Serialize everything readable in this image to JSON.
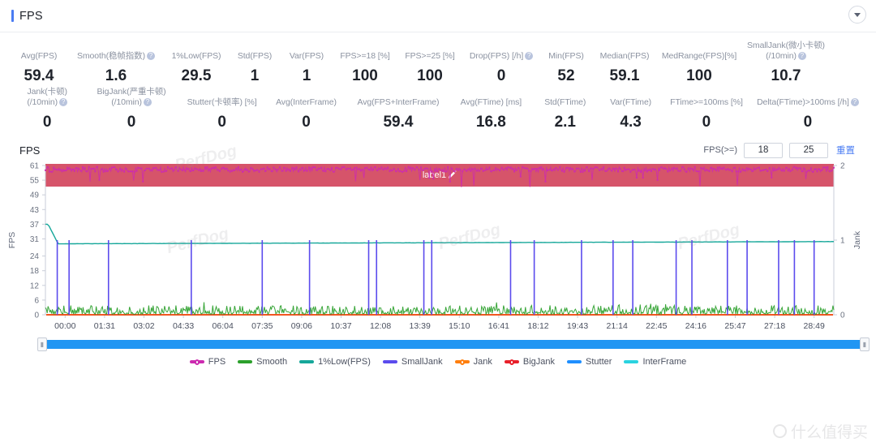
{
  "header": {
    "title": "FPS",
    "collapse_icon": "chevron-down-icon"
  },
  "metrics_rows": [
    [
      {
        "label": "Avg(FPS)",
        "value": "59.4",
        "help": false
      },
      {
        "label": "Smooth(稳帧指数)",
        "value": "1.6",
        "help": true
      },
      {
        "label": "1%Low(FPS)",
        "value": "29.5",
        "help": false
      },
      {
        "label": "Std(FPS)",
        "value": "1",
        "help": false
      },
      {
        "label": "Var(FPS)",
        "value": "1",
        "help": false
      },
      {
        "label": "FPS>=18 [%]",
        "value": "100",
        "help": false
      },
      {
        "label": "FPS>=25 [%]",
        "value": "100",
        "help": false
      },
      {
        "label": "Drop(FPS) [/h]",
        "value": "0",
        "help": true
      },
      {
        "label": "Min(FPS)",
        "value": "52",
        "help": false
      },
      {
        "label": "Median(FPS)",
        "value": "59.1",
        "help": false
      },
      {
        "label": "MedRange(FPS)[%]",
        "value": "100",
        "help": false
      },
      {
        "label": "SmallJank(微小卡顿)\n(/10min)",
        "value": "10.7",
        "help": true
      }
    ],
    [
      {
        "label": "Jank(卡顿)\n(/10min)",
        "value": "0",
        "help": true
      },
      {
        "label": "BigJank(严重卡顿)\n(/10min)",
        "value": "0",
        "help": true
      },
      {
        "label": "Stutter(卡顿率) [%]",
        "value": "0",
        "help": false
      },
      {
        "label": "Avg(InterFrame)",
        "value": "0",
        "help": false
      },
      {
        "label": "Avg(FPS+InterFrame)",
        "value": "59.4",
        "help": false
      },
      {
        "label": "Avg(FTime) [ms]",
        "value": "16.8",
        "help": false
      },
      {
        "label": "Std(FTime)",
        "value": "2.1",
        "help": false
      },
      {
        "label": "Var(FTime)",
        "value": "4.3",
        "help": false
      },
      {
        "label": "FTime>=100ms [%]",
        "value": "0",
        "help": false
      },
      {
        "label": "Delta(FTime)>100ms [/h]",
        "value": "0",
        "help": true
      }
    ]
  ],
  "chart_header": {
    "title": "FPS",
    "fps_gte_label": "FPS(>=)",
    "threshold_low": "18",
    "threshold_high": "25",
    "reset_label": "重置"
  },
  "label_band": {
    "text": "label1",
    "edit_icon": "pencil-icon",
    "color": "#d6546a"
  },
  "range_slider": {
    "start_pct": 0,
    "end_pct": 100,
    "color": "#2196f3"
  },
  "legend": [
    {
      "label": "FPS",
      "color": "#cc2bb0",
      "style": "dotted"
    },
    {
      "label": "Smooth",
      "color": "#2ca02c",
      "style": "line"
    },
    {
      "label": "1%Low(FPS)",
      "color": "#16a79a",
      "style": "line"
    },
    {
      "label": "SmallJank",
      "color": "#5b4bed",
      "style": "line"
    },
    {
      "label": "Jank",
      "color": "#ff7f0e",
      "style": "dotted"
    },
    {
      "label": "BigJank",
      "color": "#e8202a",
      "style": "dotted"
    },
    {
      "label": "Stutter",
      "color": "#1f8fff",
      "style": "line"
    },
    {
      "label": "InterFrame",
      "color": "#2ad3e0",
      "style": "line"
    }
  ],
  "watermarks": [
    "PerfDog",
    "PerfDog",
    "PerfDog",
    "PerfDog"
  ],
  "brand_watermark": "什么值得买",
  "chart_data": {
    "type": "line",
    "title": "FPS",
    "xlabel": "",
    "ylabel": "FPS",
    "y2label": "Jank",
    "ylim": [
      0,
      61
    ],
    "y2lim": [
      0,
      2
    ],
    "yticks": [
      0,
      6,
      12,
      18,
      24,
      31,
      37,
      43,
      49,
      55,
      61
    ],
    "y2ticks": [
      0,
      1,
      2
    ],
    "xticks": [
      "00:00",
      "01:31",
      "03:02",
      "04:33",
      "06:04",
      "07:35",
      "09:06",
      "10:37",
      "12:08",
      "13:39",
      "15:10",
      "16:41",
      "18:12",
      "19:43",
      "21:14",
      "22:45",
      "24:16",
      "25:47",
      "27:18",
      "28:49"
    ],
    "grid": false,
    "legend_position": "bottom",
    "series": [
      {
        "name": "FPS",
        "color": "#cc2bb0",
        "axis": "left",
        "description": "Dense scatter/line oscillating around 59-60 with occasional dips to 52-57",
        "mean": 59.4,
        "min": 52,
        "max": 61,
        "median": 59.1
      },
      {
        "name": "Smooth",
        "color": "#2ca02c",
        "axis": "left",
        "description": "Noisy low-amplitude band between 0 and 5",
        "mean": 1.6,
        "min": 0,
        "max": 5
      },
      {
        "name": "1%Low(FPS)",
        "color": "#16a79a",
        "axis": "left",
        "description": "Starts near 37, drops quickly to ~29 and stays flat",
        "mean": 29.5,
        "start": 37,
        "settle": 29.5
      },
      {
        "name": "SmallJank",
        "color": "#5b4bed",
        "axis": "right",
        "description": "Sparse unit-height spikes to 1 jank",
        "rate_per_10min": 10.7,
        "spike_value": 1,
        "spike_times_pct": [
          1.5,
          3.0,
          8.0,
          18.5,
          27.5,
          33.5,
          41.0,
          42.0,
          48.0,
          49.0,
          59.0,
          62.0,
          68.0,
          72.0,
          74.5,
          80.0,
          82.0,
          86.5,
          89.0,
          93.0,
          95.0,
          97.5
        ]
      },
      {
        "name": "Jank",
        "color": "#ff7f0e",
        "axis": "right",
        "description": "Flat at 0 across entire timeline",
        "rate_per_10min": 0,
        "constant": 0
      },
      {
        "name": "BigJank",
        "color": "#e8202a",
        "axis": "right",
        "description": "Flat at 0 across entire timeline",
        "rate_per_10min": 0,
        "constant": 0
      },
      {
        "name": "Stutter",
        "color": "#1f8fff",
        "axis": "left",
        "description": "Flat at 0 across entire timeline",
        "constant": 0
      },
      {
        "name": "InterFrame",
        "color": "#2ad3e0",
        "axis": "left",
        "description": "Flat at 0 across entire timeline",
        "constant": 0
      }
    ]
  }
}
